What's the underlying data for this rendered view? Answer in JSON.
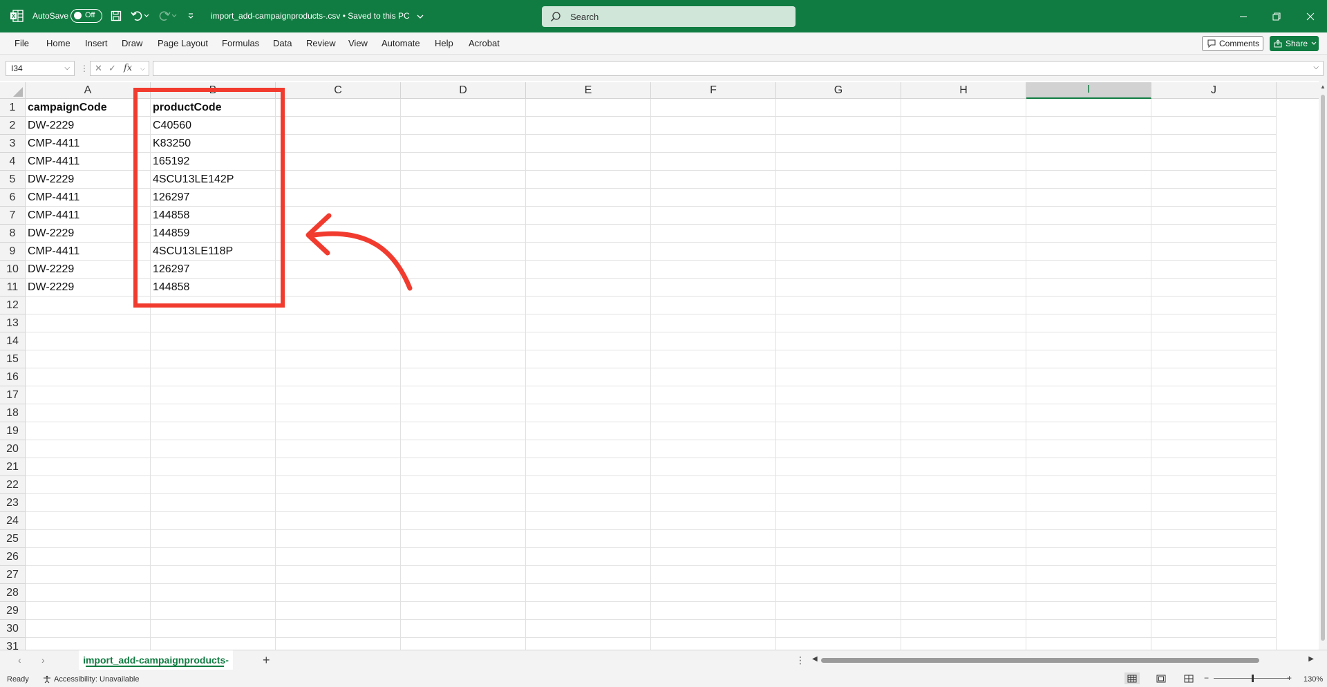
{
  "titlebar": {
    "autosave_label": "AutoSave",
    "autosave_state": "Off",
    "filename": "import_add-campaignproducts-.csv • Saved to this PC",
    "search_placeholder": "Search"
  },
  "menu": {
    "items": [
      "File",
      "Home",
      "Insert",
      "Draw",
      "Page Layout",
      "Formulas",
      "Data",
      "Review",
      "View",
      "Automate",
      "Help",
      "Acrobat"
    ],
    "comments_label": "Comments",
    "share_label": "Share"
  },
  "formula_bar": {
    "name_box": "I34",
    "fx": "fx",
    "formula": ""
  },
  "sheet": {
    "columns": [
      "A",
      "B",
      "C",
      "D",
      "E",
      "F",
      "G",
      "H",
      "I",
      "J"
    ],
    "selected_column": "I",
    "row_numbers": [
      "1",
      "2",
      "3",
      "4",
      "5",
      "6",
      "7",
      "8",
      "9",
      "10",
      "11",
      "12",
      "13",
      "14",
      "15",
      "16",
      "17",
      "18",
      "19",
      "20",
      "21",
      "22",
      "23",
      "24",
      "25",
      "26",
      "27",
      "28",
      "29",
      "30",
      "31"
    ],
    "cells": [
      [
        "campaignCode",
        "productCode"
      ],
      [
        "DW-2229",
        "C40560"
      ],
      [
        "CMP-4411",
        "K83250"
      ],
      [
        "CMP-4411",
        "165192"
      ],
      [
        "DW-2229",
        "4SCU13LE142P"
      ],
      [
        "CMP-4411",
        "126297"
      ],
      [
        "CMP-4411",
        "144858"
      ],
      [
        "DW-2229",
        "144859"
      ],
      [
        "CMP-4411",
        "4SCU13LE118P"
      ],
      [
        "DW-2229",
        "126297"
      ],
      [
        "DW-2229",
        "144858"
      ]
    ]
  },
  "tabs": {
    "active_sheet": "import_add-campaignproducts-"
  },
  "status": {
    "ready": "Ready",
    "accessibility": "Accessibility: Unavailable",
    "zoom": "130%"
  },
  "colors": {
    "excel_green": "#107c41",
    "annotation_red": "#f23b2f"
  },
  "annotation": {
    "shape": "red rectangle around column B with curved arrow pointing left"
  }
}
